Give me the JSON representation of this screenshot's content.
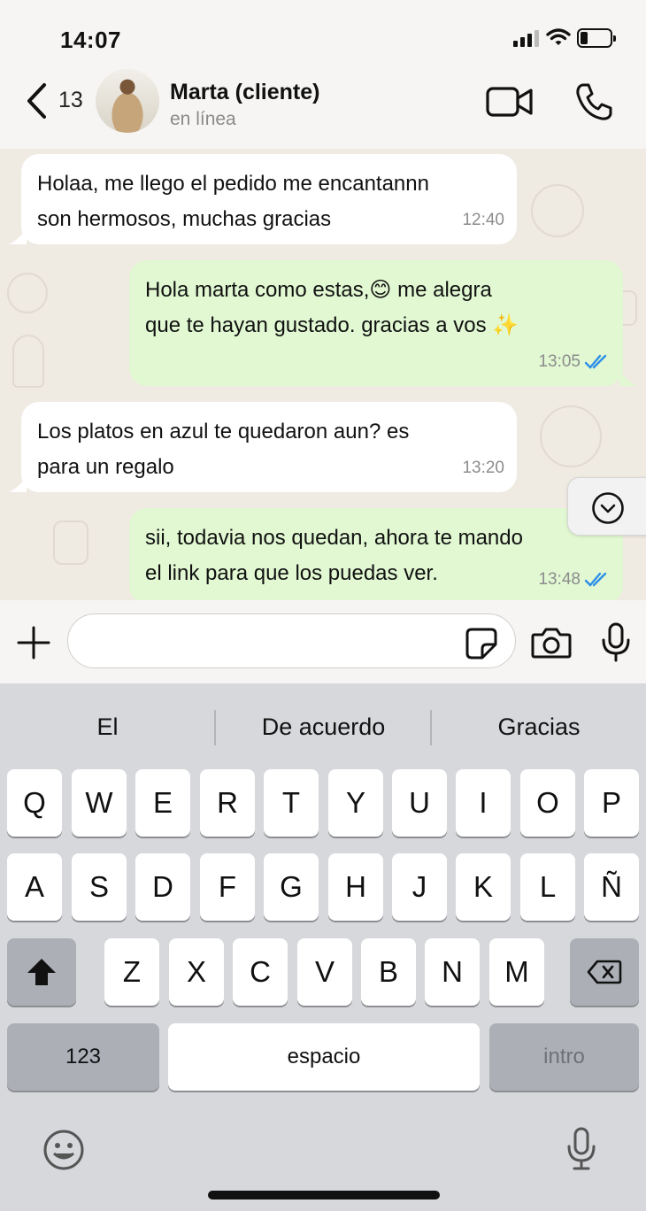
{
  "status_bar": {
    "time": "14:07"
  },
  "header": {
    "back_count": "13",
    "contact_name": "Marta (cliente)",
    "contact_status": "en línea"
  },
  "messages": [
    {
      "direction": "in",
      "lines": [
        "Holaa, me llego el pedido me encantannn",
        "son hermosos, muchas gracias"
      ],
      "time": "12:40"
    },
    {
      "direction": "out",
      "lines": [
        "Hola marta como estas,😊 me alegra",
        "que te hayan gustado. gracias a vos ✨"
      ],
      "time": "13:05",
      "status": "read"
    },
    {
      "direction": "in",
      "lines": [
        "Los platos en azul te quedaron aun? es",
        "para un regalo"
      ],
      "time": "13:20"
    },
    {
      "direction": "out",
      "lines": [
        "sii, todavia nos quedan, ahora te mando",
        "el link para que los puedas ver."
      ],
      "time": "13:48",
      "status": "read"
    }
  ],
  "composer": {
    "value": "",
    "placeholder": ""
  },
  "keyboard": {
    "suggestions": [
      "El",
      "De acuerdo",
      "Gracias"
    ],
    "row1": [
      "Q",
      "W",
      "E",
      "R",
      "T",
      "Y",
      "U",
      "I",
      "O",
      "P"
    ],
    "row2": [
      "A",
      "S",
      "D",
      "F",
      "G",
      "H",
      "J",
      "K",
      "L",
      "Ñ"
    ],
    "row3": [
      "Z",
      "X",
      "C",
      "V",
      "B",
      "N",
      "M"
    ],
    "numbers_label": "123",
    "space_label": "espacio",
    "return_label": "intro"
  },
  "icons": {
    "back": "chevron-left-icon",
    "video": "video-camera-icon",
    "call": "phone-icon",
    "scroll": "chevron-down-circle-icon",
    "attach": "plus-icon",
    "sticker": "sticker-icon",
    "camera": "camera-icon",
    "mic": "microphone-icon",
    "shift": "shift-icon",
    "delete": "backspace-icon",
    "emoji": "emoji-icon",
    "dictation": "dictation-mic-icon"
  },
  "colors": {
    "incoming_bubble": "#ffffff",
    "outgoing_bubble": "#e1f8d2",
    "read_ticks": "#2c8fe8",
    "chat_background": "#efeae2"
  }
}
